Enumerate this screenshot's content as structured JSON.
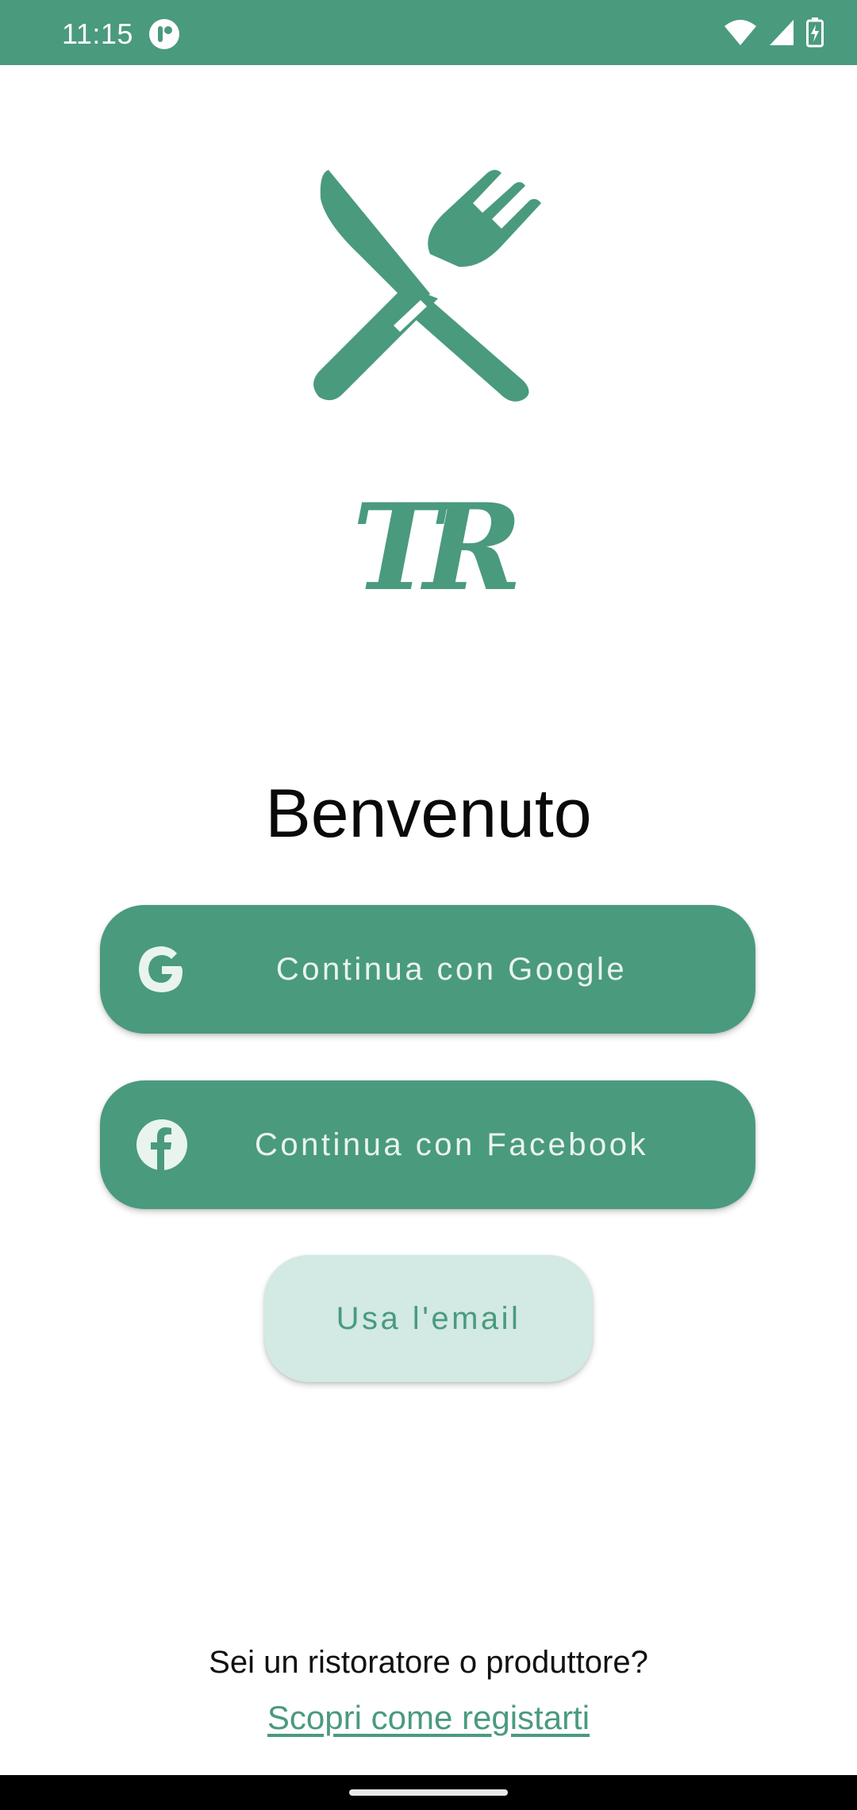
{
  "status_bar": {
    "time": "11:15",
    "icons": [
      "app-notification-icon",
      "wifi-icon",
      "signal-icon",
      "battery-charging-icon"
    ]
  },
  "logo": {
    "icon": "cutlery-icon",
    "monogram": "TR"
  },
  "welcome": {
    "title": "Benvenuto"
  },
  "buttons": {
    "google": {
      "label": "Continua con Google",
      "icon": "google-icon"
    },
    "facebook": {
      "label": "Continua con Facebook",
      "icon": "facebook-icon"
    },
    "email": {
      "label": "Usa l'email"
    }
  },
  "footer": {
    "question": "Sei un ristoratore o produttore?",
    "link": "Scopri come registarti"
  },
  "colors": {
    "primary": "#4a9a7e",
    "secondary_container": "#d2e9e4",
    "background": "#ffffff"
  }
}
